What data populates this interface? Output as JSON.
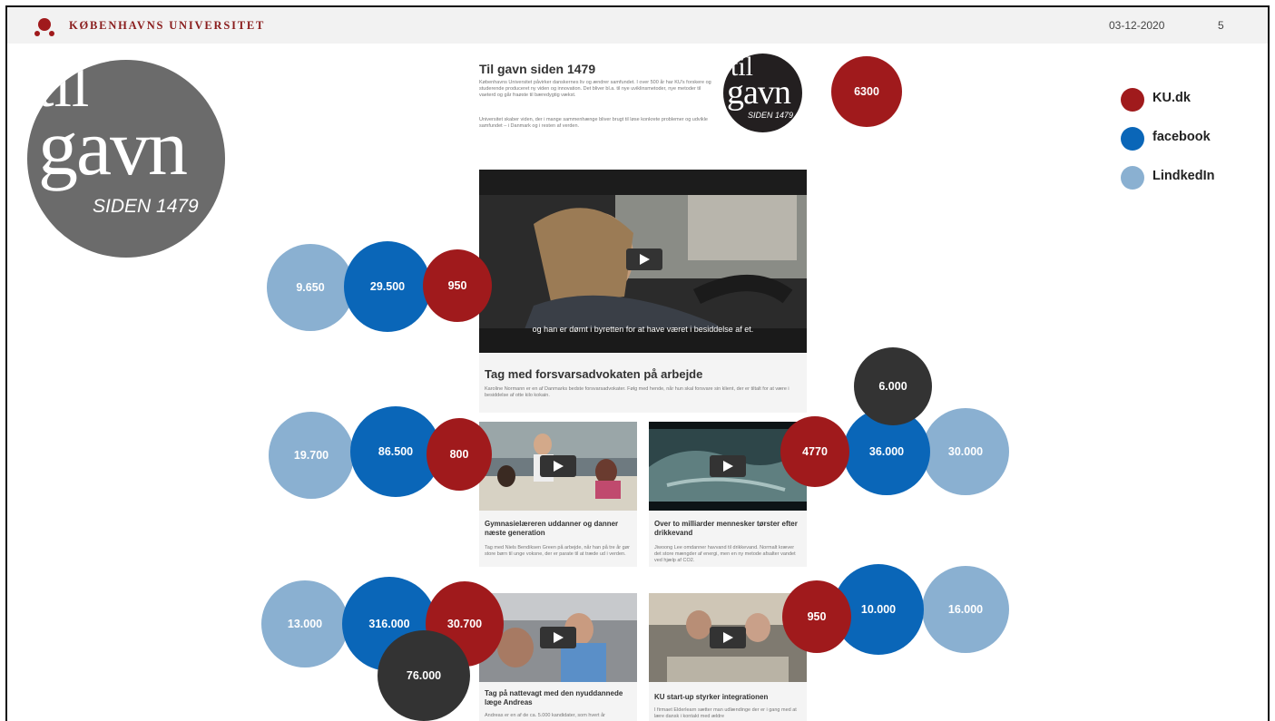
{
  "header": {
    "university": "KØBENHAVNS UNIVERSITET",
    "date": "03-12-2020",
    "page": "5"
  },
  "logo": {
    "line1": "til",
    "line2": "gavn",
    "line3": "SIDEN 1479"
  },
  "intro": {
    "title": "Til gavn siden 1479",
    "paragraph1": "Københavns Universitet påvirker danskernes liv og ændrer samfundet. I over 500 år har KU's forskere og studerende produceret ny viden og innovation. Det bliver bl.a. til nye uviklinsmetoder, nye metoder til vaeterd og går fraøste til bæredygtig vækst.",
    "paragraph2": "Universitet skaber viden, der i mange sammenhænge bliver brugt til løse konkrete problemer og udvikle samfundet – i Danmark og i resten af verden."
  },
  "legend": [
    {
      "label": "KU.dk",
      "color": "#a01a1c"
    },
    {
      "label": "facebook",
      "color": "#0a66b8"
    },
    {
      "label": "LindkedIn",
      "color": "#8ab0d1"
    }
  ],
  "cards": {
    "main": {
      "subtitle": "og han er dømt i byretten for at have været i besiddelse af et.",
      "title": "Tag med forsvarsadvokaten på arbejde",
      "desc": "Karoline Normann er en af Danmarks bedste forsvarsadvokater. Følg med hende, når hun skal forsvare sin klient, der er tiltalt for at være i besiddelse af otte kilo kokain."
    },
    "teacher": {
      "title": "Gymnasielæreren uddanner og danner næste generation",
      "desc": "Tag med Niels Bendiksen Green på arbejde, når han på tre år gør store børn til unge voksne, der er parate til at træde ud i verden."
    },
    "water": {
      "title": "Over to milliarder mennesker tørster efter drikkevand",
      "desc": "Jiwoong Lee omdanner havvand til drikkevand. Normalt kræver det store mængder af energi, men en ny metode afsalter vandet ved hjælp af CO2."
    },
    "doctor": {
      "title": "Tag på nattevagt med den nyuddannede læge Andreas",
      "desc": "Andreas er en af de ca. 5.000 kandidater, som hvert år"
    },
    "startup": {
      "title": "KU start-up styrker integrationen",
      "desc": "I firmaet Elderlearn sætter man udlændinge der er i gang med at lære dansk i kontakt med ældre"
    }
  },
  "bubbles": {
    "intro_ku": "6300",
    "main_li": "9.650",
    "main_fb": "29.500",
    "main_ku": "950",
    "teacher_li": "19.700",
    "teacher_fb": "86.500",
    "teacher_ku": "800",
    "water_ku": "4770",
    "water_fb": "36.000",
    "water_li": "30.000",
    "water_other": "6.000",
    "doctor_li": "13.000",
    "doctor_fb": "316.000",
    "doctor_ku": "30.700",
    "doctor_other": "76.000",
    "startup_ku": "950",
    "startup_fb": "10.000",
    "startup_li": "16.000"
  }
}
